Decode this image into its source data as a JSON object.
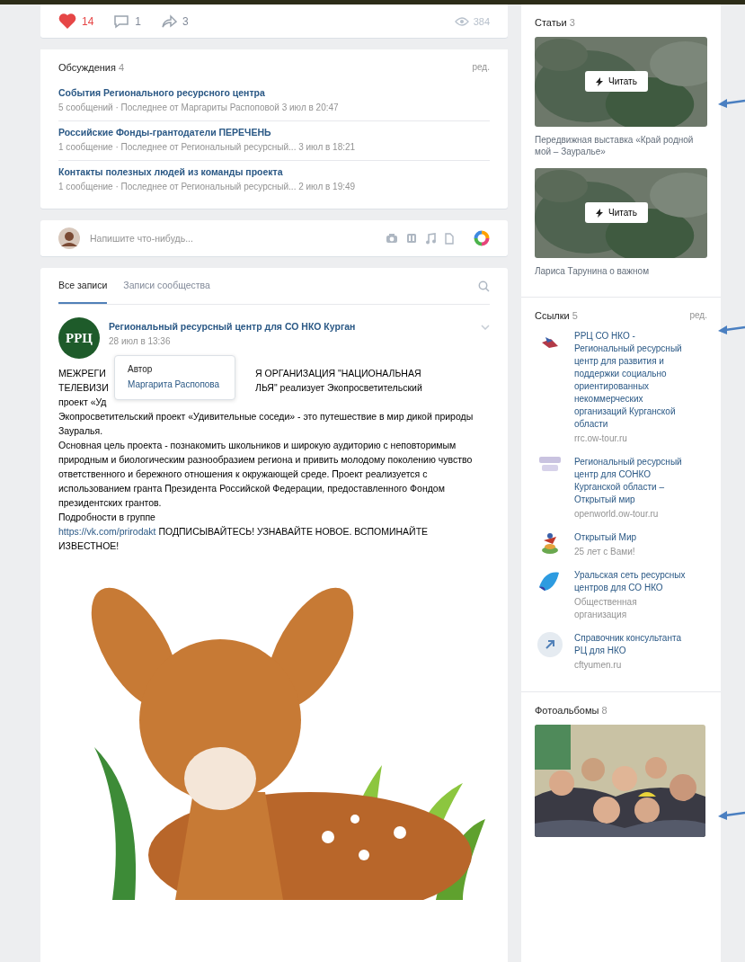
{
  "post_actions": {
    "likes": "14",
    "comments": "1",
    "shares": "3",
    "views": "384"
  },
  "discussions": {
    "title": "Обсуждения",
    "count": "4",
    "edit": "ред.",
    "items": [
      {
        "title": "События Регионального ресурсного центра",
        "meta": "5 сообщений · Последнее от Маргариты Распоповой 3 июл в 20:47"
      },
      {
        "title": "Российские Фонды-грантодатели ПЕРЕЧЕНЬ",
        "meta": "1 сообщение · Последнее от Региональный ресурсный... 3 июл в 18:21"
      },
      {
        "title": "Контакты полезных людей из команды проекта",
        "meta": "1 сообщение · Последнее от Региональный ресурсный... 2 июл в 19:49"
      }
    ]
  },
  "composer": {
    "placeholder": "Напишите что-нибудь..."
  },
  "wall": {
    "tabs": [
      {
        "label": "Все записи",
        "selected": true
      },
      {
        "label": "Записи сообщества",
        "selected": false
      }
    ]
  },
  "post": {
    "avatar_text": "РРЦ",
    "author": "Региональный ресурсный центр для СО НКО Курган",
    "date": "28 июл в 13:36",
    "tooltip": {
      "label": "Автор",
      "name": "Маргарита Распопова"
    },
    "covered_lines": [
      {
        "left": "МЕЖРЕГИ",
        "right": "Я ОРГАНИЗАЦИЯ \"НАЦИОНАЛЬНАЯ"
      },
      {
        "left": "ТЕЛЕВИЗИ",
        "right": "ЛЬЯ\" реализует Экопросветительский"
      },
      {
        "left": "проект «Уд"
      }
    ],
    "paragraphs": [
      "Экопросветительский проект «Удивительные соседи» - это путешествие в мир дикой природы Зауралья.",
      "Основная цель проекта - познакомить школьников и широкую аудиторию с неповторимым природным и биологическим разнообразием региона и привить молодому поколению чувство ответственного и бережного отношения к окружающей среде. Проект реализуется с использованием гранта Президента Российской Федерации, предоставленного Фондом президентских грантов.",
      "Подробности в группе"
    ],
    "link": "https://vk.com/prirodakt",
    "link_tail": "ПОДПИСЫВАЙТЕСЬ! УЗНАВАЙТЕ НОВОЕ. ВСПОМИНАЙТЕ ИЗВЕСТНОЕ!"
  },
  "articles": {
    "title": "Статьи",
    "count": "3",
    "items": [
      {
        "button": "Читать",
        "caption": "Передвижная выставка «Край родной мой – Зауралье»"
      },
      {
        "button": "Читать",
        "caption": "Лариса Тарунина о важном"
      }
    ]
  },
  "links": {
    "title": "Ссылки",
    "count": "5",
    "edit": "ред.",
    "items": [
      {
        "kind": "bird",
        "title": "РРЦ СО НКО - Региональный ресурсный центр для развития и поддержки социально ориентированных некоммерческих организаций Курганской области",
        "sub": "rrc.ow-tour.ru"
      },
      {
        "kind": "banner",
        "title": "Региональный ресурсный центр для СОНКО Курганской области – Открытый мир",
        "sub": "openworld.ow-tour.ru"
      },
      {
        "kind": "flower",
        "title": "Открытый Мир",
        "sub": "25 лет с Вами!"
      },
      {
        "kind": "wave",
        "title": "Уральская сеть ресурсных центров для СО НКО",
        "sub": "Общественная организация"
      },
      {
        "kind": "arrow",
        "title": "Справочник консультанта РЦ для НКО",
        "sub": "cftyumen.ru"
      }
    ]
  },
  "albums": {
    "title": "Фотоальбомы",
    "count": "8"
  }
}
